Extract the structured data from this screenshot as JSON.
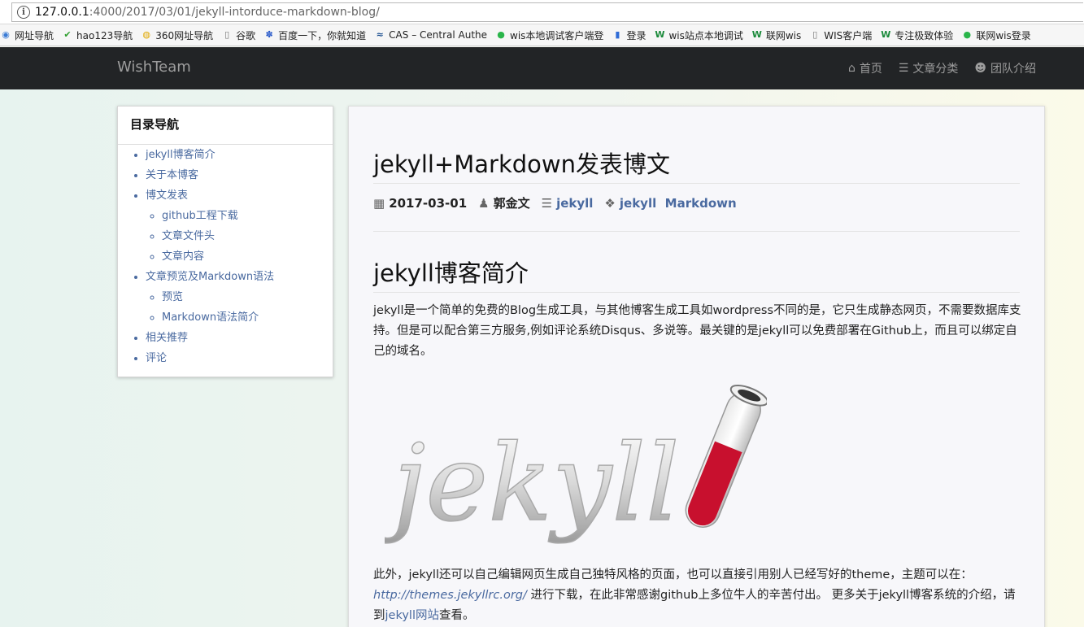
{
  "browser": {
    "url_host": "127.0.0.1",
    "url_path": ":4000/2017/03/01/jekyll-intorduce-markdown-blog/",
    "bookmarks": [
      {
        "icon": "globe-icon",
        "label": "网址导航"
      },
      {
        "icon": "hao123-icon",
        "label": "hao123导航"
      },
      {
        "icon": "360-icon",
        "label": "360网址导航"
      },
      {
        "icon": "page-icon",
        "label": "谷歌"
      },
      {
        "icon": "baidu-icon",
        "label": "百度一下，你就知道"
      },
      {
        "icon": "cas-icon",
        "label": "CAS – Central Authe"
      },
      {
        "icon": "green-dot-icon",
        "label": "wis本地调试客户端登"
      },
      {
        "icon": "bar-icon",
        "label": "登录"
      },
      {
        "icon": "w-icon",
        "label": "wis站点本地调试"
      },
      {
        "icon": "w-icon",
        "label": "联网wis"
      },
      {
        "icon": "page-icon",
        "label": "WIS客户端"
      },
      {
        "icon": "w-icon",
        "label": "专注极致体验"
      },
      {
        "icon": "green-dot-icon",
        "label": "联网wis登录"
      }
    ]
  },
  "navbar": {
    "brand": "WishTeam",
    "links": [
      {
        "icon": "home-icon",
        "label": "首页"
      },
      {
        "icon": "list-icon",
        "label": "文章分类"
      },
      {
        "icon": "users-icon",
        "label": "团队介绍"
      }
    ]
  },
  "toc": {
    "title": "目录导航",
    "items": [
      {
        "label": "jekyll博客简介"
      },
      {
        "label": "关于本博客"
      },
      {
        "label": "博文发表",
        "children": [
          "github工程下载",
          "文章文件头",
          "文章内容"
        ]
      },
      {
        "label": "文章预览及Markdown语法",
        "children": [
          "预览",
          "Markdown语法简介"
        ]
      },
      {
        "label": "相关推荐"
      },
      {
        "label": "评论"
      }
    ]
  },
  "article": {
    "title": "jekyll+Markdown发表博文",
    "date": "2017-03-01",
    "author": "郭金文",
    "category": "jekyll",
    "tags": "jekyll  Markdown",
    "section_title": "jekyll博客简介",
    "para1": "jekyll是一个简单的免费的Blog生成工具，与其他博客生成工具如wordpress不同的是，它只生成静态网页，不需要数据库支持。但是可以配合第三方服务,例如评论系统Disqus、多说等。最关键的是jekyll可以免费部署在Github上，而且可以绑定自己的域名。",
    "logo_text": "jekyll",
    "para2_a": "此外，jekyll还可以自己编辑网页生成自己独特风格的页面，也可以直接引用别人已经写好的theme，主题可以在：",
    "para2_link": "http://themes.jekyllrc.org/",
    "para2_b": " 进行下载，在此非常感谢github上多位牛人的辛苦付出。 更多关于jekyll博客系统的介绍，请到",
    "para2_link2": "jekyll网站",
    "para2_c": "查看。"
  }
}
